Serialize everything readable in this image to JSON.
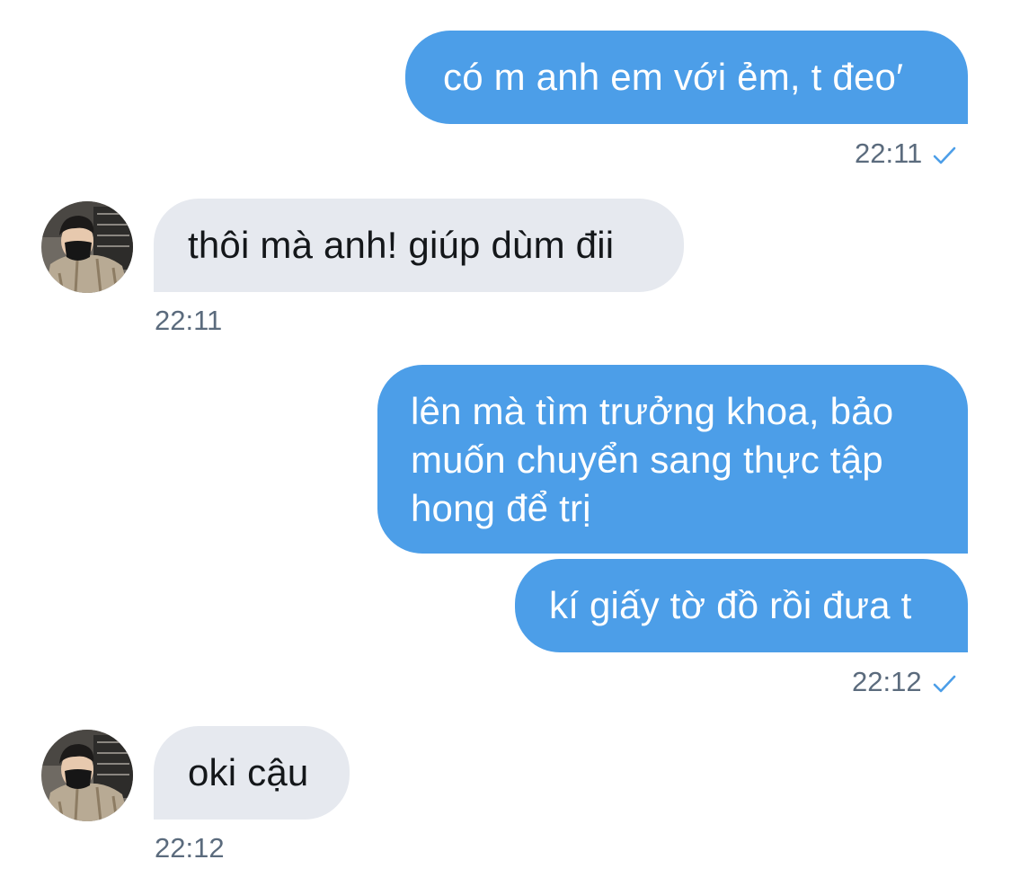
{
  "messages": [
    {
      "direction": "outgoing",
      "text": "có m anh em với ẻm, t đeo′"
    },
    {
      "direction": "outgoing",
      "time": "22:11",
      "status_icon": "checkmark-icon"
    },
    {
      "direction": "incoming",
      "avatar_icon": "user-avatar",
      "text": "thôi mà anh! giúp dùm đii",
      "time": "22:11"
    },
    {
      "direction": "outgoing",
      "text": "lên mà tìm trưởng khoa, bảo muốn chuyển sang thực tập hong để trị"
    },
    {
      "direction": "outgoing",
      "text": "kí giấy tờ đồ rồi đưa t",
      "time": "22:12",
      "status_icon": "checkmark-icon"
    },
    {
      "direction": "incoming",
      "avatar_icon": "user-avatar",
      "text": "oki cậu",
      "time": "22:12"
    }
  ],
  "colors": {
    "outgoing_bubble": "#4c9ee8",
    "incoming_bubble": "#e6e9ef",
    "timestamp": "#5b6b7d",
    "check": "#4c9ee8"
  }
}
